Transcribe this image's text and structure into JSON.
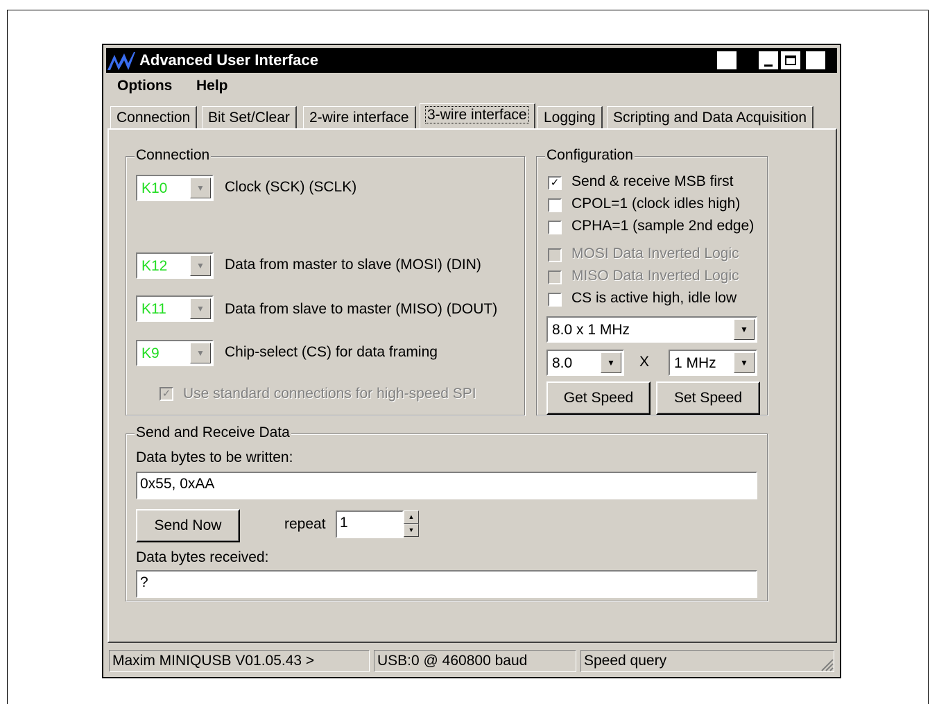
{
  "window": {
    "title": "Advanced User Interface",
    "controls": {
      "resize_icon": "double-arrow-icon",
      "minimize_icon": "minimize-icon",
      "maximize_icon": "maximize-icon",
      "close_icon": "close-icon"
    }
  },
  "menu": [
    {
      "label": "Options"
    },
    {
      "label": "Help"
    }
  ],
  "tabs": [
    {
      "label": "Connection"
    },
    {
      "label": "Bit Set/Clear"
    },
    {
      "label": "2-wire interface"
    },
    {
      "label": "3-wire interface",
      "active": true
    },
    {
      "label": "Logging"
    },
    {
      "label": "Scripting and Data Acquisition"
    }
  ],
  "connection": {
    "title": "Connection",
    "rows": [
      {
        "value": "K10",
        "label": "Clock (SCK) (SCLK)"
      },
      {
        "value": "K12",
        "label": "Data from master to slave (MOSI) (DIN)"
      },
      {
        "value": "K11",
        "label": "Data from slave to master (MISO) (DOUT)"
      },
      {
        "value": "K9",
        "label": "Chip-select (CS) for data framing"
      }
    ],
    "std_conn_label": "Use standard connections for high-speed SPI",
    "std_conn_checked": true
  },
  "configuration": {
    "title": "Configuration",
    "options": [
      {
        "label": "Send & receive MSB first",
        "checked": true,
        "enabled": true
      },
      {
        "label": "CPOL=1 (clock idles high)",
        "checked": false,
        "enabled": true
      },
      {
        "label": "CPHA=1 (sample 2nd edge)",
        "checked": false,
        "enabled": true
      },
      {
        "label": "MOSI Data Inverted Logic",
        "checked": false,
        "enabled": false
      },
      {
        "label": "MISO Data Inverted Logic",
        "checked": false,
        "enabled": false
      },
      {
        "label": "CS is active high, idle low",
        "checked": false,
        "enabled": true
      }
    ],
    "speed_select": "8.0 x 1 MHz",
    "multiplier": "8.0",
    "times": "X",
    "unit": "1 MHz",
    "get_speed": "Get Speed",
    "set_speed": "Set Speed"
  },
  "send_receive": {
    "title": "Send and Receive Data",
    "write_label": "Data bytes to be written:",
    "write_value": "0x55, 0xAA",
    "send_button": "Send Now",
    "repeat_label": "repeat",
    "repeat_value": "1",
    "received_label": "Data bytes received:",
    "received_value": "?"
  },
  "status": [
    "Maxim MINIQUSB V01.05.43 >",
    "USB:0 @ 460800 baud",
    "Speed query"
  ]
}
